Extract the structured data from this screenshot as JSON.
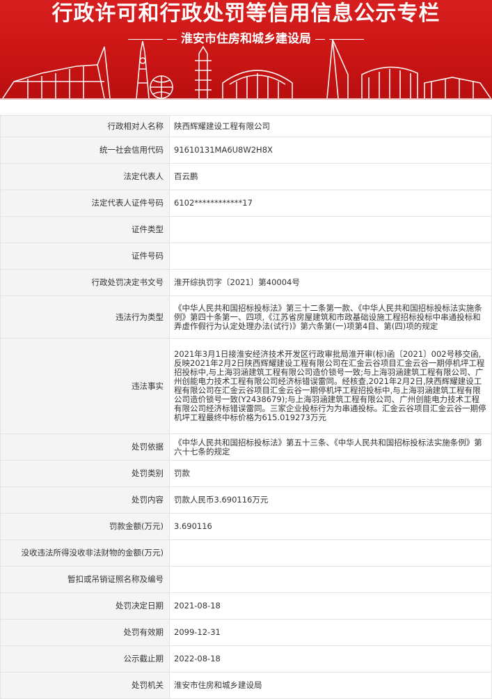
{
  "banner": {
    "title": "行政许可和行政处罚等信用信息公示专栏",
    "subtitle": "淮安市住房和城乡建设局",
    "colors": {
      "background": "#c91414",
      "text": "#ffffff"
    }
  },
  "rows": [
    {
      "label": "行政相对人名称",
      "value": "陕西辉耀建设工程有限公司"
    },
    {
      "label": "统一社会信用代码",
      "value": "91610131MA6U8W2H8X"
    },
    {
      "label": "法定代表人",
      "value": "百云鹏"
    },
    {
      "label": "法定代表人证件号码",
      "value": "6102************17"
    },
    {
      "label": "证件类型",
      "value": ""
    },
    {
      "label": "证件号码",
      "value": ""
    },
    {
      "label": "行政处罚决定书文号",
      "value": "淮开综执罚字〔2021〕第40004号"
    },
    {
      "label": "违法行为类型",
      "value": "《中华人民共和国招标投标法》第三十二条第一款、《中华人民共和国招标投标法实施条例》第四十条第一、四项,《江苏省房屋建筑和市政基础设施工程招标投标中串通投标和弄虚作假行为认定处理办法(试行)》第六条第(一)项第4目、第(四)项的规定"
    },
    {
      "label": "违法事实",
      "value": "2021年3月1日接淮安经济技术开发区行政审批局淮开审(标)函〔2021〕002号移交函,反映2021年2月2日陕西辉耀建设工程有限公司在汇金云谷项目汇金云谷一期停机坪工程招投标中,与上海羽涵建筑工程有限公司造价锁号一致;与上海羽涵建筑工程有限公司、广州创能电力技术工程有限公司经济标错误雷同。经核查,2021年2月2日,陕西辉耀建设工程有限公司在汇金云谷项目汇金云谷一期停机坪工程招投标中,与上海羽涵建筑工程有限公司造价锁号一致(Y2438679);与上海羽涵建筑工程有限公司、广州创能电力技术工程有限公司经济标错误雷同。三家企业投标行为为串通投标。汇金云谷项目汇金云谷一期停机坪工程最终中标价格为615.019273万元"
    },
    {
      "label": "处罚依据",
      "value": "《中华人民共和国招标投标法》第五十三条、《中华人民共和国招标投标法实施条例》第六十七条的规定"
    },
    {
      "label": "处罚类别",
      "value": "罚款"
    },
    {
      "label": "处罚内容",
      "value": "罚款人民币3.690116万元"
    },
    {
      "label": "罚款金额(万元)",
      "value": "3.690116"
    },
    {
      "label": "没收违法所得没收非法财物的金额(万元)",
      "value": ""
    },
    {
      "label": "暂扣或吊销证照名称及编号",
      "value": ""
    },
    {
      "label": "处罚决定日期",
      "value": "2021-08-18"
    },
    {
      "label": "处罚有效期",
      "value": "2099-12-31"
    },
    {
      "label": "公示截止期",
      "value": "2022-08-18"
    },
    {
      "label": "处罚机关",
      "value": "淮安市住房和城乡建设局"
    }
  ]
}
